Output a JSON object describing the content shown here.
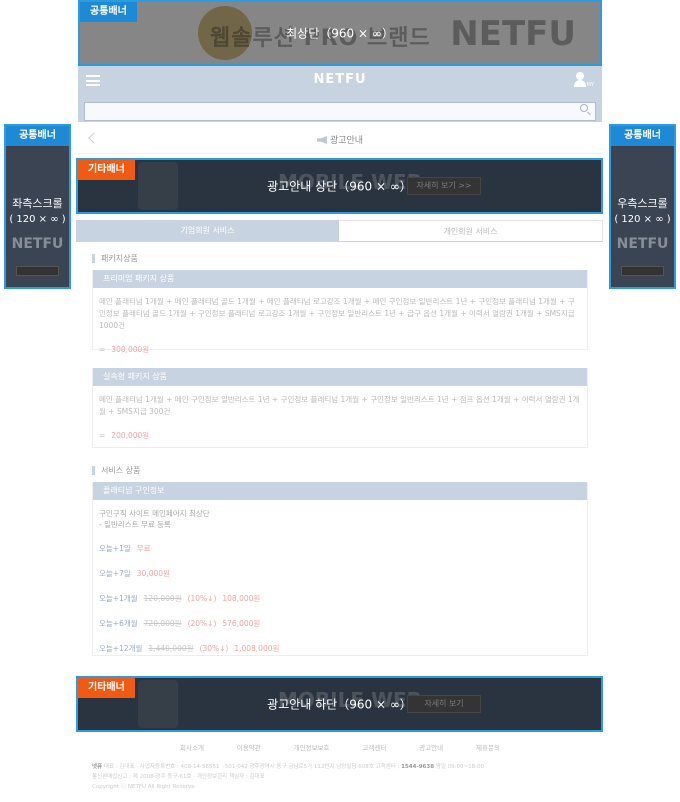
{
  "top_banner": {
    "tag": "공통배너",
    "label": "최상단（960 × ∞）",
    "bg_text": "웹솔루션 PRO 브랜드",
    "bg_logo": "NETFU"
  },
  "header": {
    "logo": "NETFU",
    "my_label": "MY"
  },
  "search": {
    "placeholder": ""
  },
  "page": {
    "title": "광고안내"
  },
  "left_banner": {
    "tag": "공통배너",
    "label": "좌측스크롤",
    "size": "( 120 × ∞ )",
    "bg_logo": "NETFU"
  },
  "right_banner": {
    "tag": "공통배너",
    "label": "우측스크롤",
    "size": "( 120 × ∞ )",
    "bg_logo": "NETFU"
  },
  "mid_banner": {
    "tag": "기타배너",
    "label": "광고안내 상단（960 × ∞）",
    "bg_text": "MOBILE WEB",
    "bg_btn": "자세히 보기 >>"
  },
  "bottom_banner": {
    "tag": "기타배너",
    "label": "광고안내 하단（960 × ∞）",
    "bg_text": "MOBILE WEB",
    "bg_btn": "자세히 보기"
  },
  "tabs": [
    {
      "label": "기업회원 서비스",
      "active": true
    },
    {
      "label": "개인회원 서비스",
      "active": false
    }
  ],
  "package_section": {
    "title": "패키지상품",
    "cards": [
      {
        "head": "프리미엄 패키지 상품",
        "desc": "메인 플래티넘 1개월 + 메인 플래티넘 골드 1개월 + 메인 플래티넘 로고강조 1개월 + 메인 구인정보 일반리스트 1년 + 구인정보 플래티넘 1개월 + 구인정보 플래티넘 골드 1개월 + 구인정보 플래티넘 로고강조 1개월 + 구인정보 일반리스트 1년 + 급구 옵션 1개월 + 이력서 열람권 1개월 + SMS지급 1000건",
        "eq": "=",
        "price": "300,000원"
      },
      {
        "head": "실속형 패키지 상품",
        "desc": "메인 플래티넘 1개월 + 메인 구인정보 일반리스트 1년 + 구인정보 플래티넘 1개월 + 구인정보 일반리스트 1년 + 점프 옵션 1개월 + 이력서 열람권 1개월 + SMS지급 300건",
        "eq": "=",
        "price": "200,000원"
      }
    ]
  },
  "service_section": {
    "title": "서비스 상품",
    "card": {
      "head": "플래티넘 구인정보",
      "desc_line1": "구인구직 사이트 메인페이지 최상단",
      "desc_line2": "- 일반리스트 무료 등록",
      "lines": [
        {
          "days": "오늘+1일",
          "old": "",
          "pct": "",
          "new": "무료"
        },
        {
          "days": "오늘+7일",
          "old": "",
          "pct": "",
          "new": "30,000원"
        },
        {
          "days": "오늘+1개월",
          "old": "120,000원",
          "pct": "(10%↓)",
          "new": "108,000원"
        },
        {
          "days": "오늘+6개월",
          "old": "720,000원",
          "pct": "(20%↓)",
          "new": "576,000원"
        },
        {
          "days": "오늘+12개월",
          "old": "1,440,000원",
          "pct": "(30%↓)",
          "new": "1,008,000원"
        }
      ]
    }
  },
  "footer": {
    "links": [
      "회사소개",
      "이용약관",
      "개인정보보호",
      "고객센터",
      "광고안내",
      "제휴문의"
    ],
    "info_line1_label": "넷퓨",
    "info_line1": "대표 : 김대표 · 사업자등록번호 : 408-14-56551 · 501-042 광주광역시 동구 금남로5가 112번지 남양빌딩 608호 고객센터 :",
    "info_phone": "1544-9638",
    "info_line1_tail": "평일 09:00~18:00",
    "info_line2": "통신판매업신고 : 제 2008-광주 동구-61호 · 개인정보관리 책임자 : 김대표",
    "info_line3": "Copyright ⓒ NETFU All Right Reserve"
  }
}
